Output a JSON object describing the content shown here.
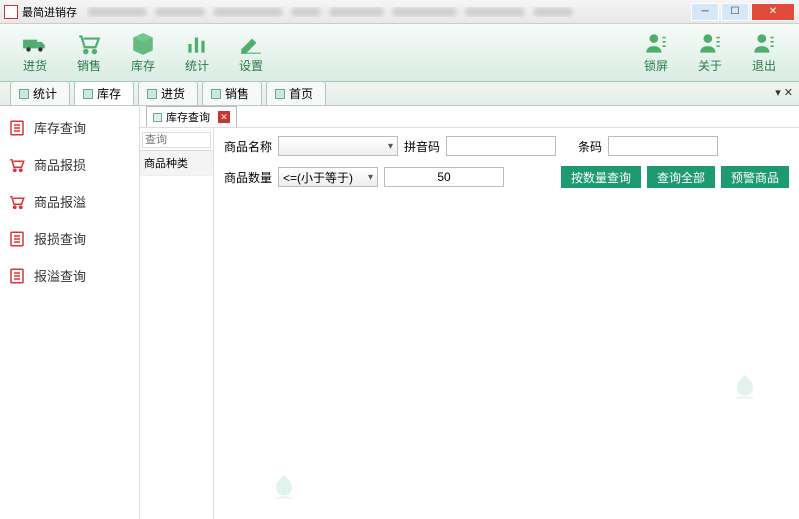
{
  "window": {
    "title": "最简进销存"
  },
  "toolbar": {
    "left": [
      {
        "name": "purchase",
        "label": "进货"
      },
      {
        "name": "sales",
        "label": "销售"
      },
      {
        "name": "inventory",
        "label": "库存"
      },
      {
        "name": "stats",
        "label": "统计"
      },
      {
        "name": "settings",
        "label": "设置"
      }
    ],
    "right": [
      {
        "name": "lock",
        "label": "锁屏"
      },
      {
        "name": "about",
        "label": "关于"
      },
      {
        "name": "exit",
        "label": "退出"
      }
    ]
  },
  "tabs": [
    {
      "name": "stats",
      "label": "统计"
    },
    {
      "name": "inventory",
      "label": "库存",
      "active": true
    },
    {
      "name": "purchase",
      "label": "进货"
    },
    {
      "name": "sales",
      "label": "销售"
    },
    {
      "name": "home",
      "label": "首页"
    }
  ],
  "sidebar": [
    {
      "name": "inv-query",
      "label": "库存查询",
      "icon": "list-red"
    },
    {
      "name": "damage",
      "label": "商品报损",
      "icon": "cart-red"
    },
    {
      "name": "overflow",
      "label": "商品报溢",
      "icon": "cart-red"
    },
    {
      "name": "damage-query",
      "label": "报损查询",
      "icon": "list-red"
    },
    {
      "name": "overflow-query",
      "label": "报溢查询",
      "icon": "list-red"
    }
  ],
  "subtab": {
    "label": "库存查询"
  },
  "tree": {
    "search_placeholder": "查询",
    "header": "商品种类"
  },
  "form": {
    "product_name_label": "商品名称",
    "pinyin_label": "拼音码",
    "barcode_label": "条码",
    "qty_label": "商品数量",
    "compare_value": "<=(小于等于)",
    "qty_value": "50",
    "btn_qty_query": "按数量查询",
    "btn_query_all": "查询全部",
    "btn_warning": "预警商品"
  }
}
